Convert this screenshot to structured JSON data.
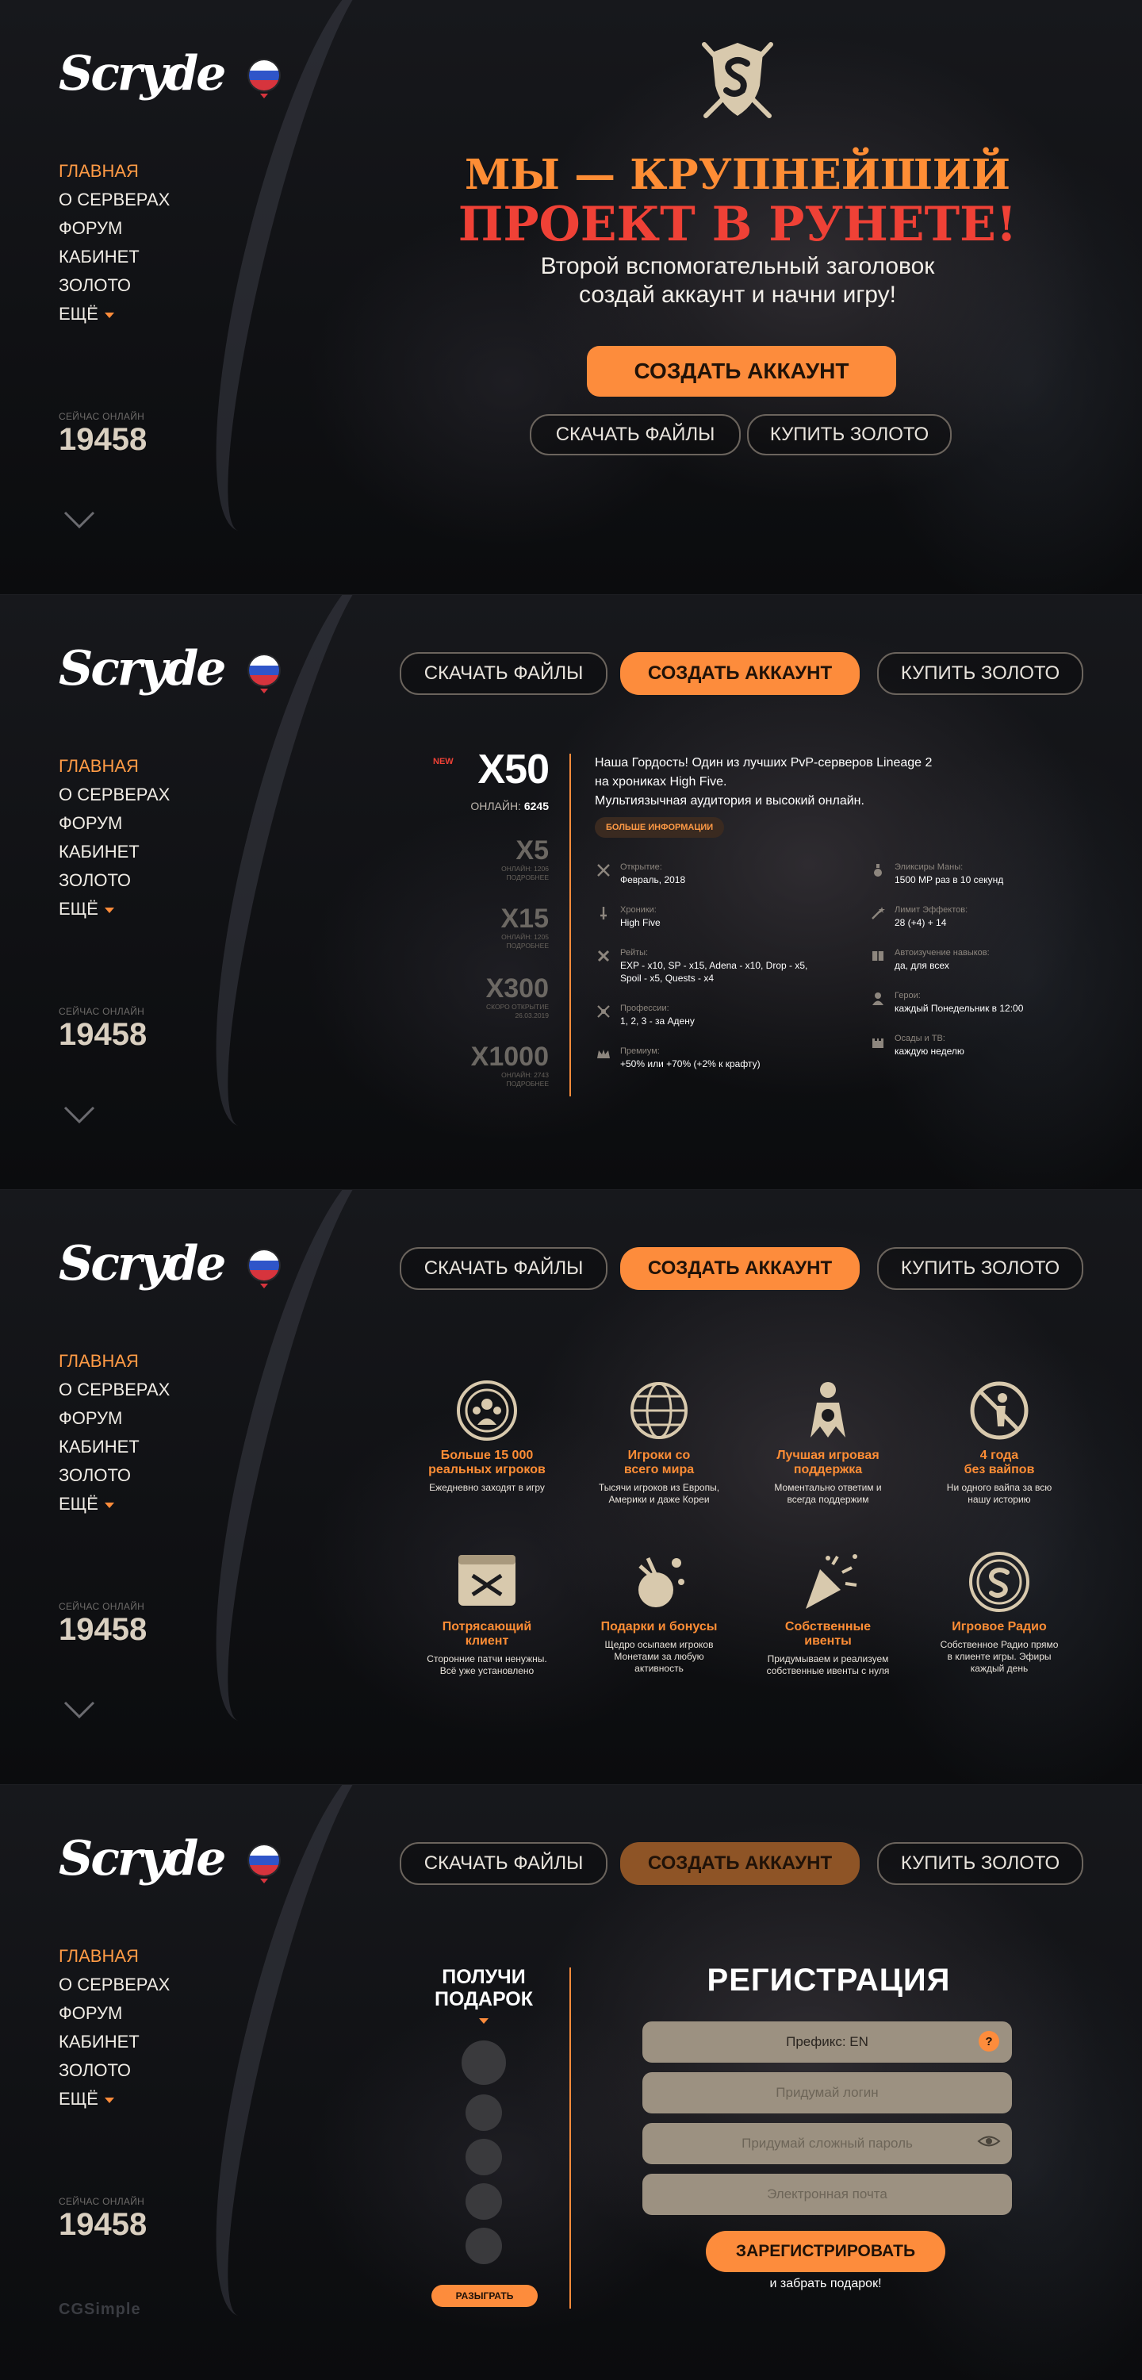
{
  "sidebar": {
    "logo": "Scryde",
    "nav": [
      "ГЛАВНАЯ",
      "О СЕРВЕРАХ",
      "ФОРУМ",
      "КАБИНЕТ",
      "ЗОЛОТО",
      "ЕЩЁ"
    ],
    "online_label": "СЕЙЧАС ОНЛАЙН",
    "online_value": "19458"
  },
  "buttons": {
    "download": "СКАЧАТЬ ФАЙЛЫ",
    "create": "СОЗДАТЬ АККАУНТ",
    "gold": "КУПИТЬ ЗОЛОТО"
  },
  "hero": {
    "line1": "МЫ — КРУПНЕЙШИЙ",
    "line2": "ПРОЕКТ В РУНЕТЕ!",
    "sub1": "Второй вспомогательный заголовок",
    "sub2": "создай аккаунт и начни игру!"
  },
  "servers": {
    "new_badge": "NEW",
    "main": {
      "name": "X50",
      "online_label": "ОНЛАЙН:",
      "online": "6245"
    },
    "others": [
      {
        "name": "X5",
        "meta1": "ОНЛАЙН: 1206",
        "meta2": "ПОДРОБНЕЕ"
      },
      {
        "name": "X15",
        "meta1": "ОНЛАЙН: 1205",
        "meta2": "ПОДРОБНЕЕ"
      },
      {
        "name": "X300",
        "meta1": "СКОРО ОТКРЫТИЕ",
        "meta2": "26.03.2019"
      },
      {
        "name": "X1000",
        "meta1": "ОНЛАЙН: 2743",
        "meta2": "ПОДРОБНЕЕ"
      }
    ],
    "desc1": "Наша Гордость! Один из лучших PvP-серверов Lineage 2",
    "desc2": "на хрониках High Five.",
    "desc3": "Мультиязычная аудитория и высокий онлайн.",
    "more": "БОЛЬШЕ ИНФОРМАЦИИ",
    "specs_left": [
      {
        "k": "Открытие:",
        "v": "Февраль, 2018",
        "icon": "swords-icon"
      },
      {
        "k": "Хроники:",
        "v": "High Five",
        "icon": "dagger-icon"
      },
      {
        "k": "Рейты:",
        "v": "EXP - x10, SP - x15, Adena - x10, Drop - x5,",
        "v2": "Spoil - x5, Quests - x4",
        "icon": "cross-icon"
      },
      {
        "k": "Профессии:",
        "v": "1, 2, 3 - за Адену",
        "icon": "axes-icon"
      },
      {
        "k": "Премиум:",
        "v": "+50% или +70% (+2% к крафту)",
        "icon": "crown-icon"
      }
    ],
    "specs_right": [
      {
        "k": "Эликсиры Маны:",
        "v": "1500 MP раз в 10 секунд",
        "icon": "potion-icon"
      },
      {
        "k": "Лимит Эффектов:",
        "v": "28 (+4) + 14",
        "icon": "wand-icon"
      },
      {
        "k": "Автоизучение навыков:",
        "v": "да, для всех",
        "icon": "book-icon"
      },
      {
        "k": "Герои:",
        "v": "каждый Понедельник в 12:00",
        "icon": "hero-icon"
      },
      {
        "k": "Осады и ТВ:",
        "v": "каждую неделю",
        "icon": "castle-icon"
      }
    ]
  },
  "features": [
    {
      "t1": "Больше 15 000",
      "t2": "реальных игроков",
      "d1": "Ежедневно заходят в игру",
      "d2": "",
      "icon": "players-icon"
    },
    {
      "t1": "Игроки со",
      "t2": "всего мира",
      "d1": "Тысячи игроков из Европы,",
      "d2": "Америки и даже Кореи",
      "icon": "globe-icon"
    },
    {
      "t1": "Лучшая игровая",
      "t2": "поддержка",
      "d1": "Моментально ответим и",
      "d2": "всегда поддержим",
      "icon": "support-icon"
    },
    {
      "t1": "4 года",
      "t2": "без вайпов",
      "d1": "Ни одного вайпа за всю",
      "d2": "нашу историю",
      "icon": "no-wipe-icon"
    },
    {
      "t1": "Потрясающий",
      "t2": "клиент",
      "d1": "Сторонние патчи ненужны.",
      "d2": "Всё уже установлено",
      "icon": "client-icon"
    },
    {
      "t1": "Подарки и бонусы",
      "t2": "",
      "d1": "Щедро осыпаем игроков",
      "d2": "Монетами за любую",
      "d3": "активность",
      "icon": "gift-icon"
    },
    {
      "t1": "Собственные",
      "t2": "ивенты",
      "d1": "Придумываем и реализуем",
      "d2": "собственные ивенты с нуля",
      "icon": "party-icon"
    },
    {
      "t1": "Игровое Радио",
      "t2": "",
      "d1": "Собственное Радио прямо",
      "d2": "в клиенте игры. Эфиры",
      "d3": "каждый день",
      "icon": "radio-icon"
    }
  ],
  "gift": {
    "title1": "ПОЛУЧИ",
    "title2": "ПОДАРОК",
    "button": "РАЗЫГРАТЬ"
  },
  "registration": {
    "title": "РЕГИСТРАЦИЯ",
    "prefix_value": "Префикс: EN",
    "help": "?",
    "login_placeholder": "Придумай логин",
    "password_placeholder": "Придумай сложный пароль",
    "email_placeholder": "Электронная почта",
    "submit": "ЗАРЕГИСТРИРОВАТЬ",
    "note": "и забрать подарок!"
  },
  "credit": "CGSimple",
  "colors": {
    "accent": "#fd8c3c",
    "red": "#ef4136",
    "flag_white": "#ffffff",
    "flag_blue": "#2f55c9",
    "flag_red": "#d7343d"
  }
}
